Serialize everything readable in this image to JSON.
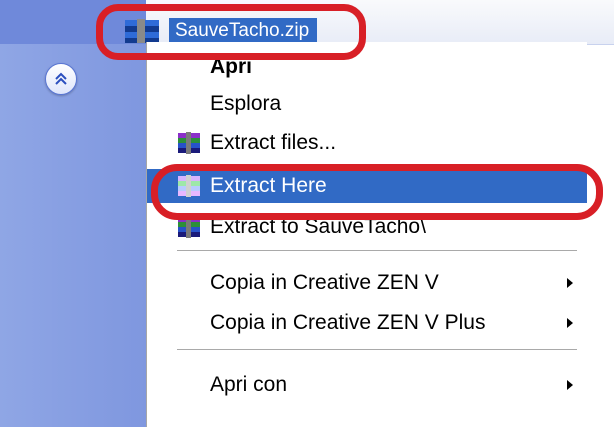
{
  "file": {
    "name": "SauveTacho.zip",
    "icon": "winrar-archive-icon",
    "selected": true
  },
  "task_pane": {
    "collapse_icon": "double-chevron-up-icon"
  },
  "context_menu": {
    "items": [
      {
        "label": "Apri",
        "bold": true
      },
      {
        "label": "Esplora"
      },
      {
        "label": "Extract files...",
        "icon": "winrar-icon"
      },
      {
        "label": "Extract Here",
        "icon": "winrar-icon",
        "highlighted": true
      },
      {
        "label": "Extract to SauveTacho\\",
        "icon": "winrar-icon"
      },
      {
        "label": "Copia in Creative ZEN V",
        "submenu": true
      },
      {
        "label": "Copia in Creative ZEN V Plus",
        "submenu": true
      },
      {
        "label": "Apri con",
        "submenu": true
      }
    ]
  },
  "colors": {
    "selection": "#316ac5",
    "annotation": "#d81f26",
    "task_pane": "#8fa6e5"
  }
}
